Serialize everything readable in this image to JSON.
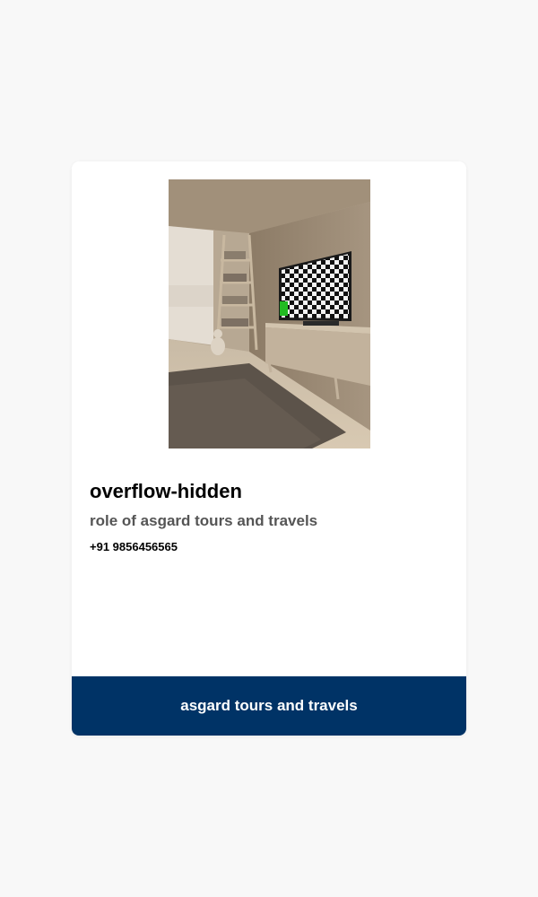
{
  "card": {
    "image_alt": "room interior with tv",
    "title": "overflow-hidden",
    "subtitle": "role of asgard tours and travels",
    "phone": "+91 9856456565",
    "footer_label": "asgard tours and travels"
  },
  "colors": {
    "page_background": "#f8f8f8",
    "card_background": "#ffffff",
    "footer_background": "#003366",
    "subtitle_text": "#555555"
  }
}
